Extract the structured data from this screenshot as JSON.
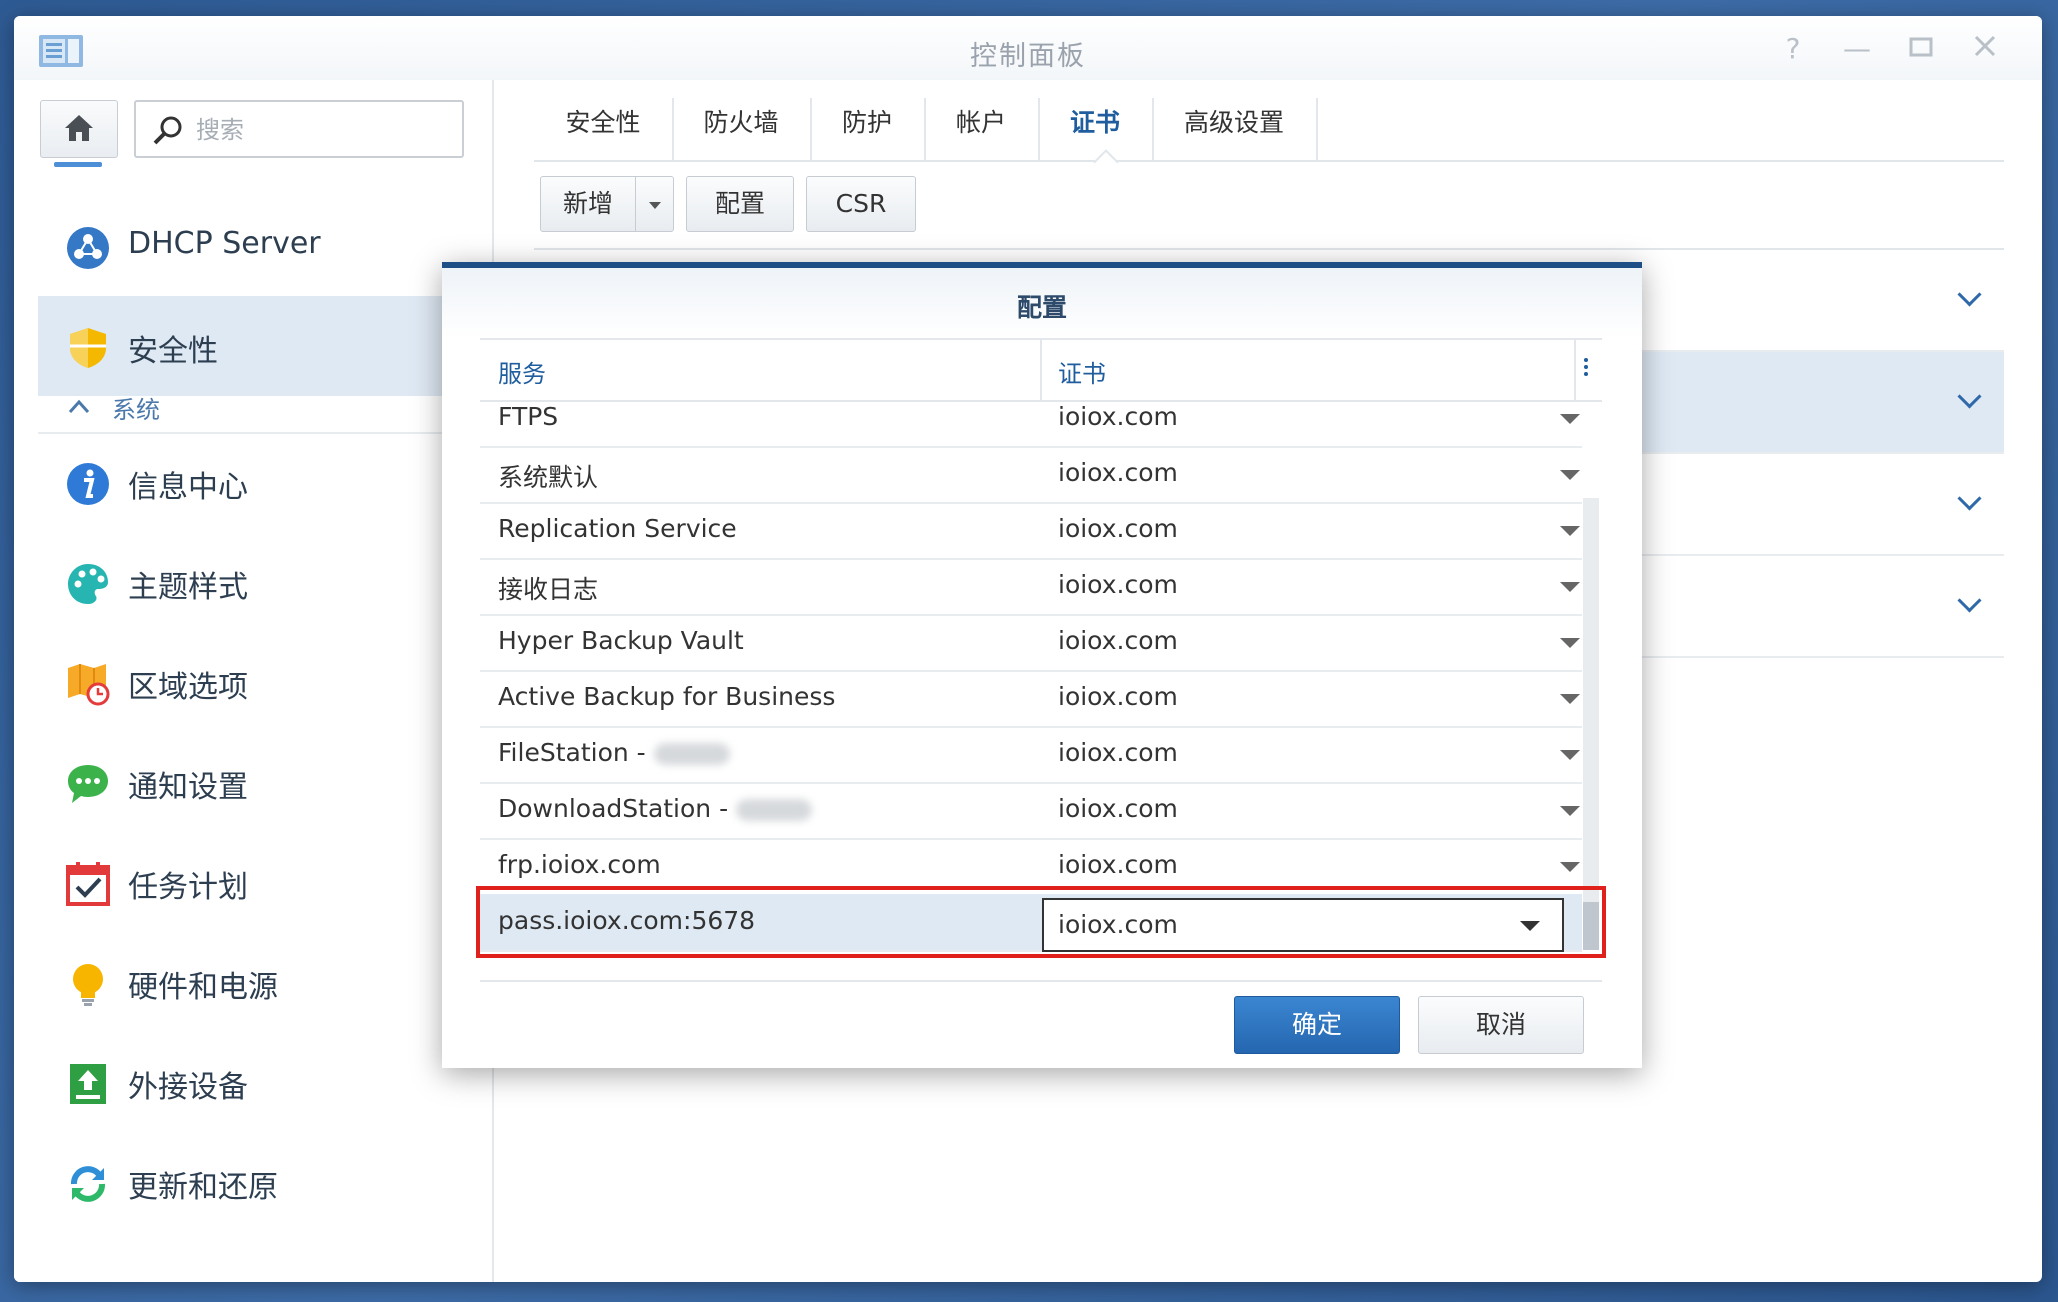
{
  "window": {
    "title": "控制面板"
  },
  "search": {
    "placeholder": "搜索"
  },
  "sidebar": {
    "items_top": [
      {
        "label": "DHCP Server",
        "icon": "dhcp-server-icon"
      },
      {
        "label": "安全性",
        "icon": "shield-icon",
        "active": true
      }
    ],
    "group": {
      "label": "系统"
    },
    "items": [
      {
        "label": "信息中心",
        "icon": "info-icon"
      },
      {
        "label": "主题样式",
        "icon": "palette-icon"
      },
      {
        "label": "区域选项",
        "icon": "map-clock-icon"
      },
      {
        "label": "通知设置",
        "icon": "chat-bubble-icon"
      },
      {
        "label": "任务计划",
        "icon": "calendar-check-icon"
      },
      {
        "label": "硬件和电源",
        "icon": "bulb-icon"
      },
      {
        "label": "外接设备",
        "icon": "upload-device-icon"
      },
      {
        "label": "更新和还原",
        "icon": "refresh-icon"
      }
    ]
  },
  "tabs": [
    {
      "label": "安全性"
    },
    {
      "label": "防火墙"
    },
    {
      "label": "防护"
    },
    {
      "label": "帐户"
    },
    {
      "label": "证书",
      "active": true
    },
    {
      "label": "高级设置"
    }
  ],
  "toolbar": {
    "add_label": "新增",
    "config_label": "配置",
    "csr_label": "CSR"
  },
  "dialog": {
    "title": "配置",
    "columns": {
      "service": "服务",
      "certificate": "证书"
    },
    "rows": [
      {
        "service": "FTPS",
        "certificate": "ioiox.com"
      },
      {
        "service": "系统默认",
        "certificate": "ioiox.com"
      },
      {
        "service": "Replication Service",
        "certificate": "ioiox.com"
      },
      {
        "service": "接收日志",
        "certificate": "ioiox.com"
      },
      {
        "service": "Hyper Backup Vault",
        "certificate": "ioiox.com"
      },
      {
        "service": "Active Backup for Business",
        "certificate": "ioiox.com"
      },
      {
        "service": "FileStation -",
        "certificate": "ioiox.com",
        "redacted": true
      },
      {
        "service": "DownloadStation -",
        "certificate": "ioiox.com",
        "redacted": true
      },
      {
        "service": "frp.ioiox.com",
        "certificate": "ioiox.com"
      },
      {
        "service": "pass.ioiox.com:5678",
        "certificate": "ioiox.com",
        "selected": true
      }
    ],
    "ok_label": "确定",
    "cancel_label": "取消"
  },
  "colors": {
    "accent": "#2566b0",
    "highlight": "#e0201b",
    "selection": "#dfe9f4"
  }
}
